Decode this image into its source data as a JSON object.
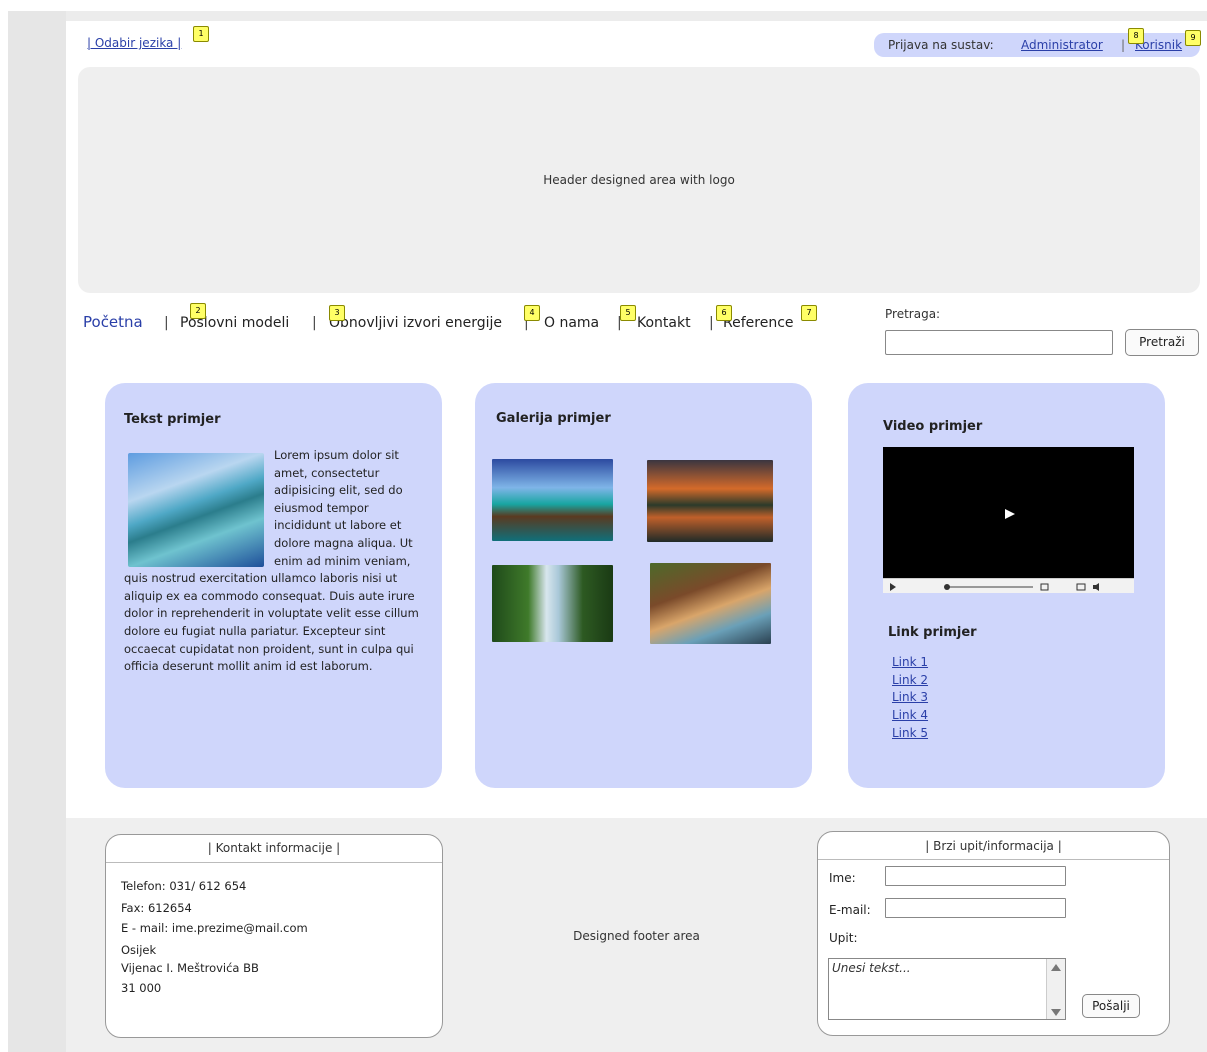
{
  "top": {
    "language_link": "| Odabir jezika |",
    "login_label": "Prijava na sustav:",
    "login_admin": "Administrator",
    "login_separator": "|",
    "login_user": "Korisnik"
  },
  "badges": [
    "1",
    "2",
    "3",
    "4",
    "5",
    "6",
    "7",
    "8",
    "9"
  ],
  "header": {
    "text": "Header designed area with logo"
  },
  "nav": {
    "items": [
      "Početna",
      "Poslovni modeli",
      "Obnovljivi izvori energije",
      "O nama",
      "Kontakt",
      "Reference"
    ],
    "separator": "|"
  },
  "search": {
    "label": "Pretraga:",
    "button": "Pretraži",
    "value": ""
  },
  "panels": {
    "text": {
      "title": "Tekst primjer",
      "body": "Lorem ipsum dolor sit amet, consectetur adipisicing elit, sed do eiusmod tempor incididunt ut labore et dolore magna aliqua. Ut enim ad minim veniam, quis nostrud exercitation ullamco laboris nisi ut aliquip ex ea commodo consequat. Duis aute irure dolor in reprehenderit in voluptate velit esse cillum dolore eu fugiat nulla pariatur. Excepteur sint occaecat cupidatat non proident, sunt in culpa qui officia deserunt mollit anim id est laborum."
    },
    "gallery": {
      "title": "Galerija primjer"
    },
    "video": {
      "title": "Video primjer"
    },
    "links": {
      "title": "Link primjer",
      "items": [
        "Link 1",
        "Link 2",
        "Link 3",
        "Link 4",
        "Link 5"
      ]
    }
  },
  "footer": {
    "center_text": "Designed footer area",
    "contact": {
      "title": "| Kontakt informacije |",
      "lines": [
        "Telefon: 031/ 612 654",
        "Fax: 612654",
        "E - mail: ime.prezime@mail.com",
        "Osijek",
        "Vijenac I. Meštrovića BB",
        "31 000"
      ]
    },
    "form": {
      "title": "| Brzi upit/informacija |",
      "name_label": "Ime:",
      "email_label": "E-mail:",
      "query_label": "Upit:",
      "textarea_placeholder": "Unesi tekst...",
      "send_button": "Pošalji"
    }
  }
}
